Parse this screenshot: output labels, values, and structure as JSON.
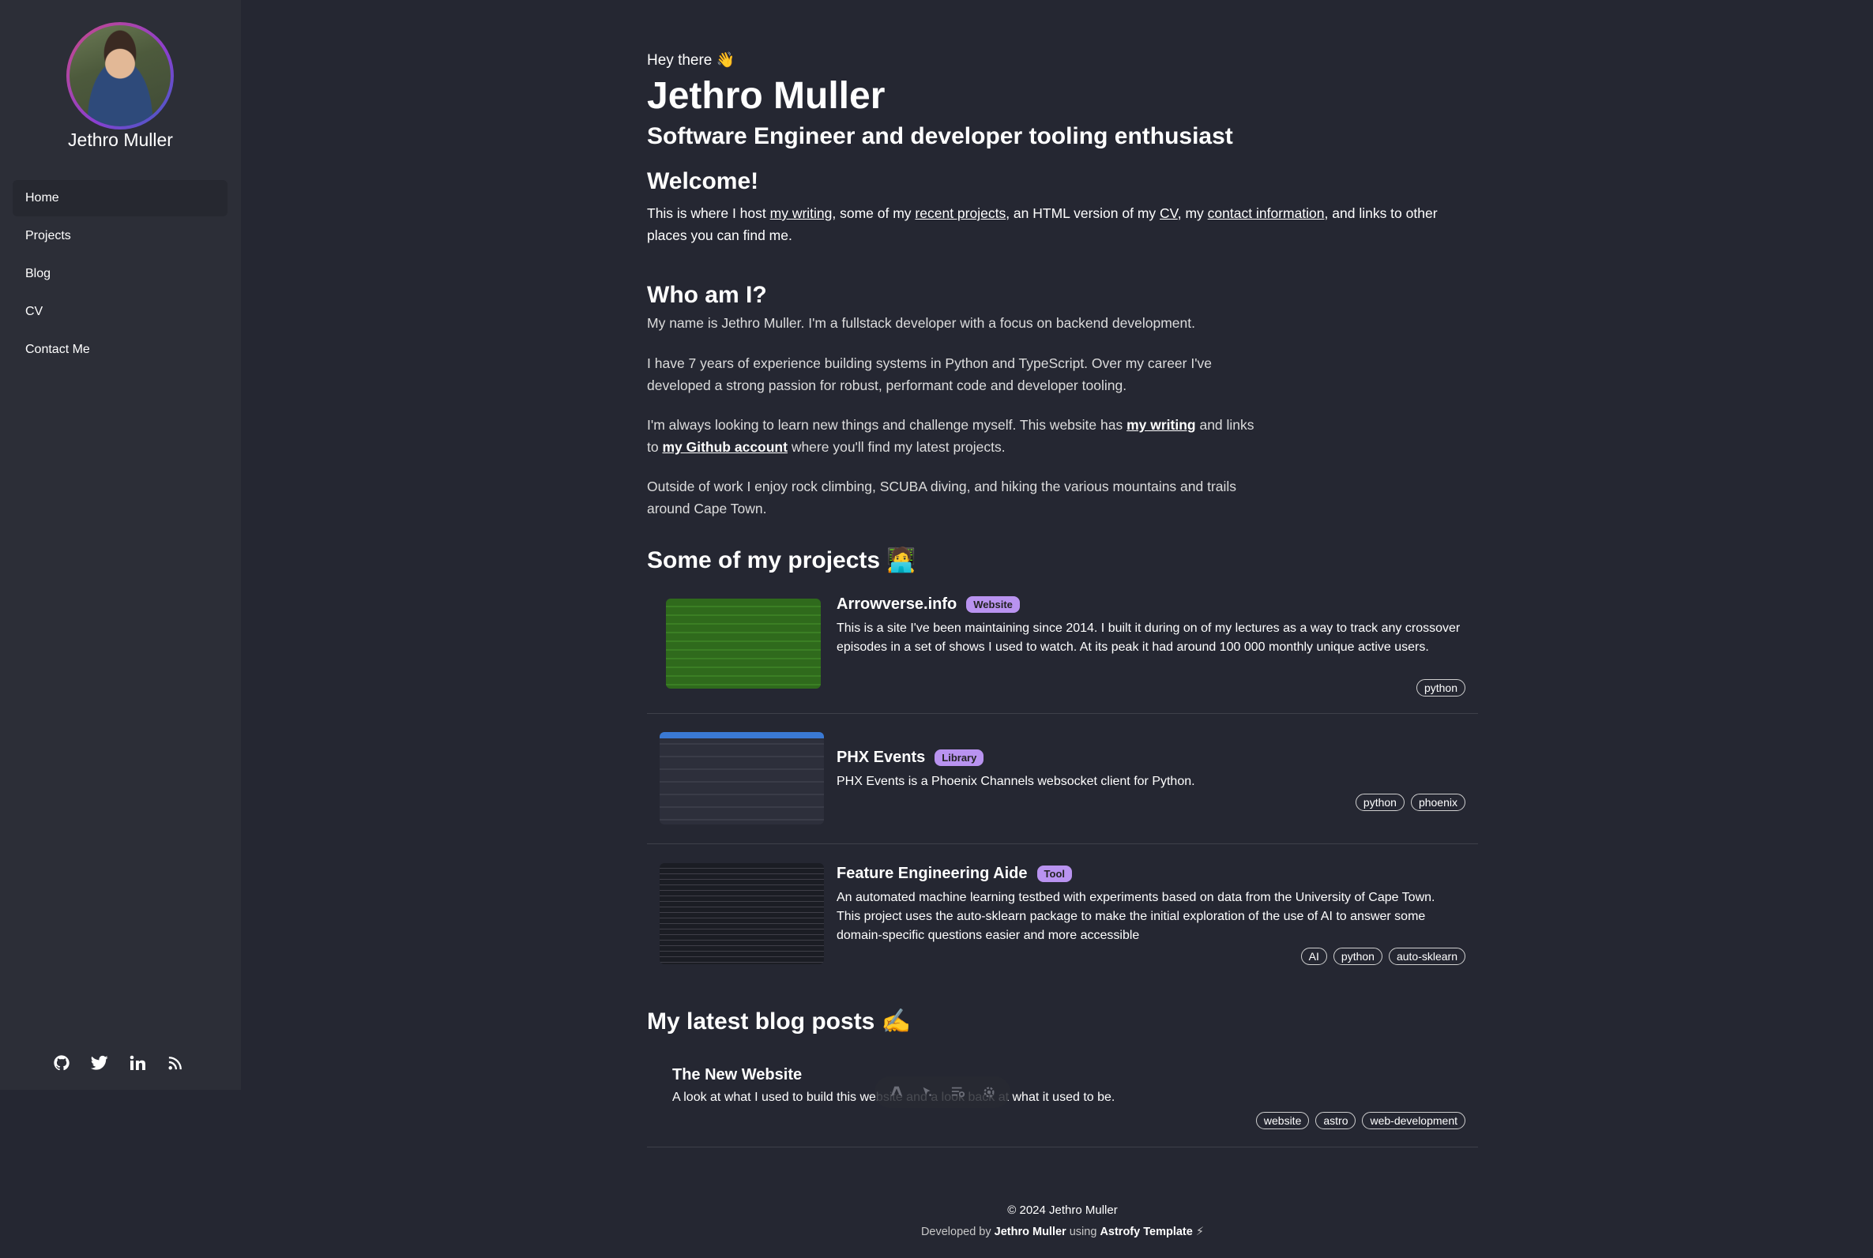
{
  "sidebar": {
    "name": "Jethro Muller",
    "nav": [
      "Home",
      "Projects",
      "Blog",
      "CV",
      "Contact Me"
    ],
    "socials": [
      "github-icon",
      "twitter-icon",
      "linkedin-icon",
      "rss-icon"
    ]
  },
  "hero": {
    "greeting": "Hey there 👋",
    "name": "Jethro Muller",
    "role": "Software Engineer and developer tooling enthusiast"
  },
  "welcome": {
    "heading": "Welcome!",
    "t1": "This is where I host ",
    "l1": "my writing",
    "t2": ", some of my ",
    "l2": "recent projects",
    "t3": ", an HTML version of my ",
    "l3": "CV",
    "t4": ", my ",
    "l4": "contact information",
    "t5": ", and links to other places you can find me."
  },
  "who": {
    "heading": "Who am I?",
    "p1": "My name is Jethro Muller. I'm a fullstack developer with a focus on backend development.",
    "p2": "I have 7 years of experience building systems in Python and TypeScript. Over my career I've developed a strong passion for robust, performant code and developer tooling.",
    "p3a": "I'm always looking to learn new things and challenge myself. This website has ",
    "p3l1": "my writing",
    "p3b": " and links to ",
    "p3l2": "my Github account",
    "p3c": " where you'll find my latest projects.",
    "p4": "Outside of work I enjoy rock climbing, SCUBA diving, and hiking the various mountains and trails around Cape Town."
  },
  "projects": {
    "heading": "Some of my projects 🧑‍💻",
    "items": [
      {
        "title": "Arrowverse.info",
        "badge": "Website",
        "desc": "This is a site I've been maintaining since 2014. I built it during on of my lectures as a way to track any crossover episodes in a set of shows I used to watch. At its peak it had around 100 000 monthly unique active users.",
        "tags": [
          "python"
        ]
      },
      {
        "title": "PHX Events",
        "badge": "Library",
        "desc": "PHX Events is a Phoenix Channels websocket client for Python.",
        "tags": [
          "python",
          "phoenix"
        ]
      },
      {
        "title": "Feature Engineering Aide",
        "badge": "Tool",
        "desc": "An automated machine learning testbed with experiments based on data from the University of Cape Town. This project uses the auto-sklearn package to make the initial exploration of the use of AI to answer some domain-specific questions easier and more accessible",
        "tags": [
          "AI",
          "python",
          "auto-sklearn"
        ]
      }
    ]
  },
  "blog": {
    "heading": "My latest blog posts ✍️",
    "posts": [
      {
        "title": "The New Website",
        "desc": "A look at what I used to build this website and a look back at what it used to be.",
        "tags": [
          "website",
          "astro",
          "web-development"
        ]
      }
    ]
  },
  "footer": {
    "copyright": "© 2024 Jethro Muller",
    "dev_prefix": "Developed by ",
    "dev_name": "Jethro Muller",
    "dev_mid": " using ",
    "dev_template": "Astrofy Template",
    "dev_suffix": " ⚡"
  }
}
